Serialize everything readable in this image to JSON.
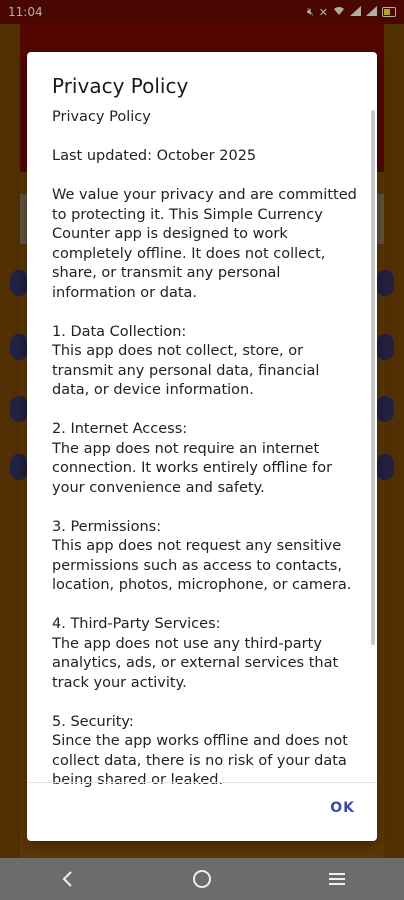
{
  "status": {
    "time": "11:04",
    "icons": [
      "mute-icon",
      "no-signal-icon",
      "wifi-icon",
      "signal-icon",
      "signal-icon",
      "battery-icon"
    ]
  },
  "dialog": {
    "title": "Privacy Policy",
    "paragraphs": [
      "Privacy Policy",
      "Last updated: October 2025",
      "We value your privacy and are committed to protecting it. This Simple Currency Counter app is designed to work completely offline. It does not collect, share, or transmit any personal information or data.",
      "1. Data Collection:\nThis app does not collect, store, or transmit any personal data, financial data, or device information.",
      "2. Internet Access:\nThe app does not require an internet connection. It works entirely offline for your convenience and safety.",
      "3. Permissions:\nThis app does not request any sensitive permissions such as access to contacts, location, photos, microphone, or camera.",
      "4. Third-Party Services:\nThe app does not use any third-party analytics, ads, or external services that track your activity.",
      "5. Security:\nSince the app works offline and does not collect data, there is no risk of your data being shared or leaked."
    ],
    "ok_label": "OK"
  },
  "navbar": {
    "back": "back-icon",
    "home": "home-icon",
    "recents": "recents-icon"
  },
  "colors": {
    "accent": "#3d4aa8",
    "status_bar": "#5a0000",
    "background": "#6b3f05"
  }
}
